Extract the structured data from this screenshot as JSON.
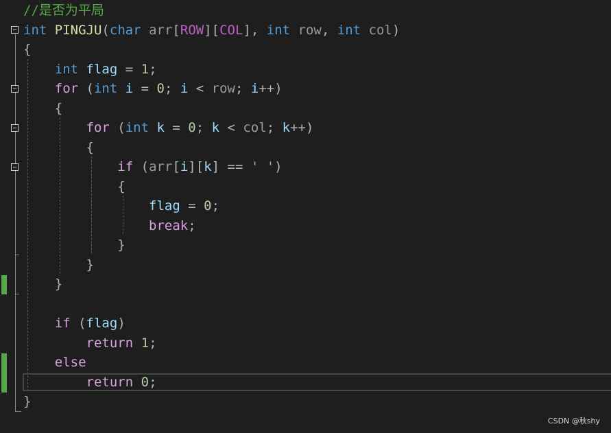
{
  "editor": {
    "lines": [
      [
        {
          "t": "//是否为平局",
          "c": "cmt"
        }
      ],
      [
        {
          "t": "int",
          "c": "kw"
        },
        {
          "t": " ",
          "c": "pun"
        },
        {
          "t": "PINGJU",
          "c": "fn"
        },
        {
          "t": "(",
          "c": "pun"
        },
        {
          "t": "char",
          "c": "kw"
        },
        {
          "t": " ",
          "c": "pun"
        },
        {
          "t": "arr",
          "c": "par"
        },
        {
          "t": "[",
          "c": "pun"
        },
        {
          "t": "ROW",
          "c": "mac"
        },
        {
          "t": "][",
          "c": "pun"
        },
        {
          "t": "COL",
          "c": "mac"
        },
        {
          "t": "], ",
          "c": "pun"
        },
        {
          "t": "int",
          "c": "kw"
        },
        {
          "t": " ",
          "c": "pun"
        },
        {
          "t": "row",
          "c": "par"
        },
        {
          "t": ", ",
          "c": "pun"
        },
        {
          "t": "int",
          "c": "kw"
        },
        {
          "t": " ",
          "c": "pun"
        },
        {
          "t": "col",
          "c": "par"
        },
        {
          "t": ")",
          "c": "pun"
        }
      ],
      [
        {
          "t": "{",
          "c": "pun"
        }
      ],
      [
        {
          "t": "    ",
          "c": "pun"
        },
        {
          "t": "int",
          "c": "kw"
        },
        {
          "t": " ",
          "c": "pun"
        },
        {
          "t": "flag",
          "c": "var"
        },
        {
          "t": " = ",
          "c": "pun"
        },
        {
          "t": "1",
          "c": "num"
        },
        {
          "t": ";",
          "c": "pun"
        }
      ],
      [
        {
          "t": "    ",
          "c": "pun"
        },
        {
          "t": "for",
          "c": "ctl"
        },
        {
          "t": " (",
          "c": "pun"
        },
        {
          "t": "int",
          "c": "kw"
        },
        {
          "t": " ",
          "c": "pun"
        },
        {
          "t": "i",
          "c": "var"
        },
        {
          "t": " = ",
          "c": "pun"
        },
        {
          "t": "0",
          "c": "num"
        },
        {
          "t": "; ",
          "c": "pun"
        },
        {
          "t": "i",
          "c": "var"
        },
        {
          "t": " < ",
          "c": "pun"
        },
        {
          "t": "row",
          "c": "par"
        },
        {
          "t": "; ",
          "c": "pun"
        },
        {
          "t": "i",
          "c": "var"
        },
        {
          "t": "++)",
          "c": "pun"
        }
      ],
      [
        {
          "t": "    {",
          "c": "pun"
        }
      ],
      [
        {
          "t": "        ",
          "c": "pun"
        },
        {
          "t": "for",
          "c": "ctl"
        },
        {
          "t": " (",
          "c": "pun"
        },
        {
          "t": "int",
          "c": "kw"
        },
        {
          "t": " ",
          "c": "pun"
        },
        {
          "t": "k",
          "c": "var"
        },
        {
          "t": " = ",
          "c": "pun"
        },
        {
          "t": "0",
          "c": "num"
        },
        {
          "t": "; ",
          "c": "pun"
        },
        {
          "t": "k",
          "c": "var"
        },
        {
          "t": " < ",
          "c": "pun"
        },
        {
          "t": "col",
          "c": "par"
        },
        {
          "t": "; ",
          "c": "pun"
        },
        {
          "t": "k",
          "c": "var"
        },
        {
          "t": "++)",
          "c": "pun"
        }
      ],
      [
        {
          "t": "        {",
          "c": "pun"
        }
      ],
      [
        {
          "t": "            ",
          "c": "pun"
        },
        {
          "t": "if",
          "c": "ctl"
        },
        {
          "t": " (",
          "c": "pun"
        },
        {
          "t": "arr",
          "c": "par"
        },
        {
          "t": "[",
          "c": "pun"
        },
        {
          "t": "i",
          "c": "var"
        },
        {
          "t": "][",
          "c": "pun"
        },
        {
          "t": "k",
          "c": "var"
        },
        {
          "t": "] == ",
          "c": "pun"
        },
        {
          "t": "' '",
          "c": "str"
        },
        {
          "t": ")",
          "c": "pun"
        }
      ],
      [
        {
          "t": "            {",
          "c": "pun"
        }
      ],
      [
        {
          "t": "                ",
          "c": "pun"
        },
        {
          "t": "flag",
          "c": "var"
        },
        {
          "t": " = ",
          "c": "pun"
        },
        {
          "t": "0",
          "c": "num"
        },
        {
          "t": ";",
          "c": "pun"
        }
      ],
      [
        {
          "t": "                ",
          "c": "pun"
        },
        {
          "t": "break",
          "c": "ctl"
        },
        {
          "t": ";",
          "c": "pun"
        }
      ],
      [
        {
          "t": "            }",
          "c": "pun"
        }
      ],
      [
        {
          "t": "        }",
          "c": "pun"
        }
      ],
      [
        {
          "t": "    }",
          "c": "pun"
        }
      ],
      [],
      [
        {
          "t": "    ",
          "c": "pun"
        },
        {
          "t": "if",
          "c": "ctl"
        },
        {
          "t": " (",
          "c": "pun"
        },
        {
          "t": "flag",
          "c": "var"
        },
        {
          "t": ")",
          "c": "pun"
        }
      ],
      [
        {
          "t": "        ",
          "c": "pun"
        },
        {
          "t": "return",
          "c": "ctl"
        },
        {
          "t": " ",
          "c": "pun"
        },
        {
          "t": "1",
          "c": "num"
        },
        {
          "t": ";",
          "c": "pun"
        }
      ],
      [
        {
          "t": "    ",
          "c": "pun"
        },
        {
          "t": "else",
          "c": "ctl"
        }
      ],
      [
        {
          "t": "        ",
          "c": "pun"
        },
        {
          "t": "return",
          "c": "ctl"
        },
        {
          "t": " ",
          "c": "pun"
        },
        {
          "t": "0",
          "c": "num"
        },
        {
          "t": ";",
          "c": "pun"
        }
      ],
      [
        {
          "t": "}",
          "c": "pun"
        }
      ]
    ]
  },
  "colors": {
    "background": "#1e1e1e",
    "keyword": "#569cd6",
    "control": "#d8a0df",
    "function": "#dcdcaa",
    "variable": "#9cdcfe",
    "parameter": "#9a9a9a",
    "macro": "#bd63c5",
    "number": "#b5cea8",
    "string": "#d69d85",
    "comment": "#57a64a",
    "change_bar": "#57a64a"
  },
  "icons": [
    "collapse-icon"
  ],
  "watermark": "CSDN @秋shy"
}
